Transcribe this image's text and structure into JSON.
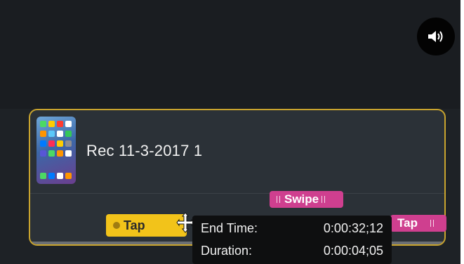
{
  "volume": {
    "icon": "speaker-volume-icon"
  },
  "clip": {
    "title": "Rec 11-3-2017 1",
    "thumbnail": "phone-home-screen-thumbnail",
    "accent_color": "#c9a42e"
  },
  "gestures": {
    "swipe_label": "Swipe",
    "swipe_color": "#cf3f8f",
    "tap_yellow_label": "Tap",
    "tap_yellow_color": "#f2c31a",
    "tap_pink_label": "Tap",
    "tap_pink_color": "#cf3f8f"
  },
  "cursor": {
    "icon": "move-cursor-icon"
  },
  "tooltip": {
    "end_time_label": "End Time:",
    "end_time_value": "0:00:32;12",
    "duration_label": "Duration:",
    "duration_value": "0:00:04;05"
  }
}
